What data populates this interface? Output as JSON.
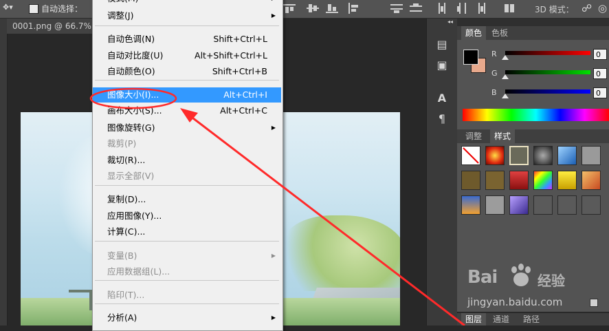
{
  "option_bar": {
    "auto_select_label": "自动选择：",
    "mode_3d_label": "3D 模式："
  },
  "document": {
    "tab_title": "0001.png @ 66.7%"
  },
  "menu": {
    "items": [
      {
        "label": "模式(M)",
        "shortcut": "",
        "submenu": true,
        "disabled": false,
        "highlighted": false
      },
      {
        "label": "调整(J)",
        "shortcut": "",
        "submenu": true,
        "disabled": false,
        "highlighted": false
      },
      {
        "label": "自动色调(N)",
        "shortcut": "Shift+Ctrl+L",
        "submenu": false,
        "disabled": false,
        "highlighted": false
      },
      {
        "label": "自动对比度(U)",
        "shortcut": "Alt+Shift+Ctrl+L",
        "submenu": false,
        "disabled": false,
        "highlighted": false
      },
      {
        "label": "自动颜色(O)",
        "shortcut": "Shift+Ctrl+B",
        "submenu": false,
        "disabled": false,
        "highlighted": false
      },
      {
        "label": "图像大小(I)...",
        "shortcut": "Alt+Ctrl+I",
        "submenu": false,
        "disabled": false,
        "highlighted": true
      },
      {
        "label": "画布大小(S)...",
        "shortcut": "Alt+Ctrl+C",
        "submenu": false,
        "disabled": false,
        "highlighted": false
      },
      {
        "label": "图像旋转(G)",
        "shortcut": "",
        "submenu": true,
        "disabled": false,
        "highlighted": false
      },
      {
        "label": "裁剪(P)",
        "shortcut": "",
        "submenu": false,
        "disabled": true,
        "highlighted": false
      },
      {
        "label": "裁切(R)...",
        "shortcut": "",
        "submenu": false,
        "disabled": false,
        "highlighted": false
      },
      {
        "label": "显示全部(V)",
        "shortcut": "",
        "submenu": false,
        "disabled": true,
        "highlighted": false
      },
      {
        "label": "复制(D)...",
        "shortcut": "",
        "submenu": false,
        "disabled": false,
        "highlighted": false
      },
      {
        "label": "应用图像(Y)...",
        "shortcut": "",
        "submenu": false,
        "disabled": false,
        "highlighted": false
      },
      {
        "label": "计算(C)...",
        "shortcut": "",
        "submenu": false,
        "disabled": false,
        "highlighted": false
      },
      {
        "label": "变量(B)",
        "shortcut": "",
        "submenu": true,
        "disabled": true,
        "highlighted": false
      },
      {
        "label": "应用数据组(L)...",
        "shortcut": "",
        "submenu": false,
        "disabled": true,
        "highlighted": false
      },
      {
        "label": "陷印(T)...",
        "shortcut": "",
        "submenu": false,
        "disabled": true,
        "highlighted": false
      },
      {
        "label": "分析(A)",
        "shortcut": "",
        "submenu": true,
        "disabled": false,
        "highlighted": false
      }
    ]
  },
  "color_panel": {
    "tabs": [
      "颜色",
      "色板"
    ],
    "sliders": [
      {
        "label": "R",
        "value": "0"
      },
      {
        "label": "G",
        "value": "0"
      },
      {
        "label": "B",
        "value": "0"
      }
    ],
    "foreground_color": "#000000",
    "background_color": "#e8a98c"
  },
  "styles_panel": {
    "tabs": [
      "调整",
      "样式"
    ]
  },
  "layers_panel": {
    "tabs": [
      "图层",
      "通道",
      "路径"
    ]
  },
  "watermark": {
    "brand_left": "Bai",
    "brand_right": "经验",
    "url": "jingyan.baidu.com"
  },
  "colors": {
    "highlight": "#3399ff",
    "annotation_red": "#ff2a2a"
  }
}
